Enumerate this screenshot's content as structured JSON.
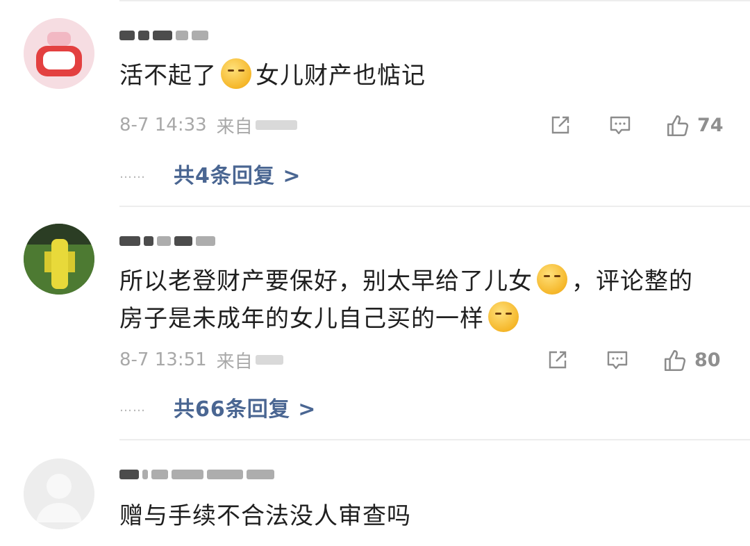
{
  "comments": [
    {
      "text_parts": [
        "活不起了",
        "女儿财产也惦记"
      ],
      "emoji": "grin-sweat-emoji",
      "time": "8-7 14:33",
      "from_label": "来自",
      "like_count": "74",
      "replies_label": "共4条回复 >"
    },
    {
      "text_line1_a": "所以老登财产要保好，别太早给了儿女",
      "text_line1_b": "，评论整的",
      "text_line2": "房子是未成年的女儿自己买的一样",
      "emoji": "shushing-face-emoji",
      "time": "8-7 13:51",
      "from_label": "来自",
      "like_count": "80",
      "replies_label": "共66条回复 >"
    },
    {
      "text": "赠与手续不合法没人审查吗"
    }
  ],
  "ui": {
    "reply_dots": "……",
    "accent_color": "#4a6692",
    "meta_color": "#a8a8a8",
    "icons": [
      "share-icon",
      "comment-icon",
      "like-icon"
    ]
  }
}
